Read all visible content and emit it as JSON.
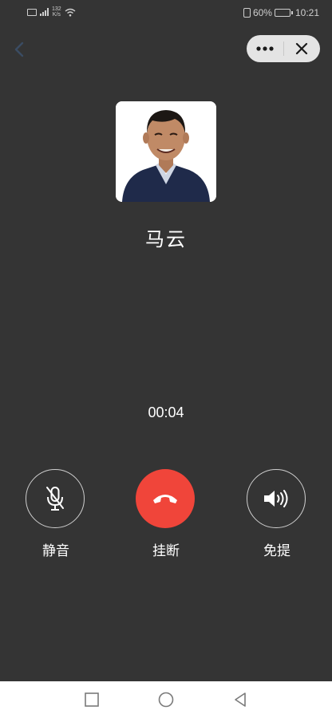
{
  "status_bar": {
    "network_text": "132\nK/s",
    "battery_percent": "60%",
    "time": "10:21",
    "battery_level": 0.6
  },
  "call": {
    "caller_name": "马云",
    "duration": "00:04"
  },
  "controls": {
    "mute_label": "静音",
    "hangup_label": "挂断",
    "speaker_label": "免提"
  },
  "colors": {
    "background": "#343434",
    "hangup": "#f0453a",
    "capsule": "#e4e4e4"
  },
  "icons": {
    "back": "chevron-left-icon",
    "more": "more-dots-icon",
    "close": "close-icon",
    "mute": "mic-off-icon",
    "hangup": "phone-hangup-icon",
    "speaker": "speaker-icon",
    "nav_recent": "square-icon",
    "nav_home": "circle-icon",
    "nav_back": "triangle-back-icon"
  }
}
